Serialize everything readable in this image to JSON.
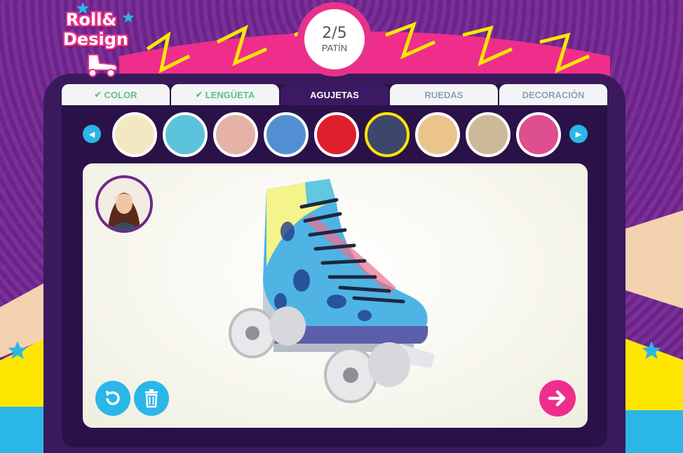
{
  "app": {
    "logo_line1": "Roll&",
    "logo_line2": "Design"
  },
  "step": {
    "count": "2/5",
    "label": "PATÍN"
  },
  "tabs": [
    {
      "label": "COLOR",
      "state": "done"
    },
    {
      "label": "LENGÜETA",
      "state": "done"
    },
    {
      "label": "AGUJETAS",
      "state": "active"
    },
    {
      "label": "RUEDAS",
      "state": "pending"
    },
    {
      "label": "DECORACIÓN",
      "state": "pending"
    }
  ],
  "swatches": [
    {
      "color": "#f2e9c2"
    },
    {
      "color": "#5bc3dc"
    },
    {
      "color": "#e6b1a6"
    },
    {
      "color": "#528fd2"
    },
    {
      "color": "#dd1f2e"
    },
    {
      "color": "#3c476b",
      "selected": true
    },
    {
      "color": "#ebc48c"
    },
    {
      "color": "#ccb999"
    },
    {
      "color": "#de4f8f"
    }
  ],
  "icons": {
    "prev": "arrow-left-icon",
    "next": "arrow-right-icon",
    "undo": "undo-icon",
    "trash": "trash-icon",
    "proceed": "arrow-right-icon",
    "tab_check": "check-icon"
  },
  "colors": {
    "accent_pink": "#e8328a",
    "accent_blue": "#2bb6e8",
    "panel_dark": "#2a1248",
    "selected_ring": "#ffe600"
  }
}
